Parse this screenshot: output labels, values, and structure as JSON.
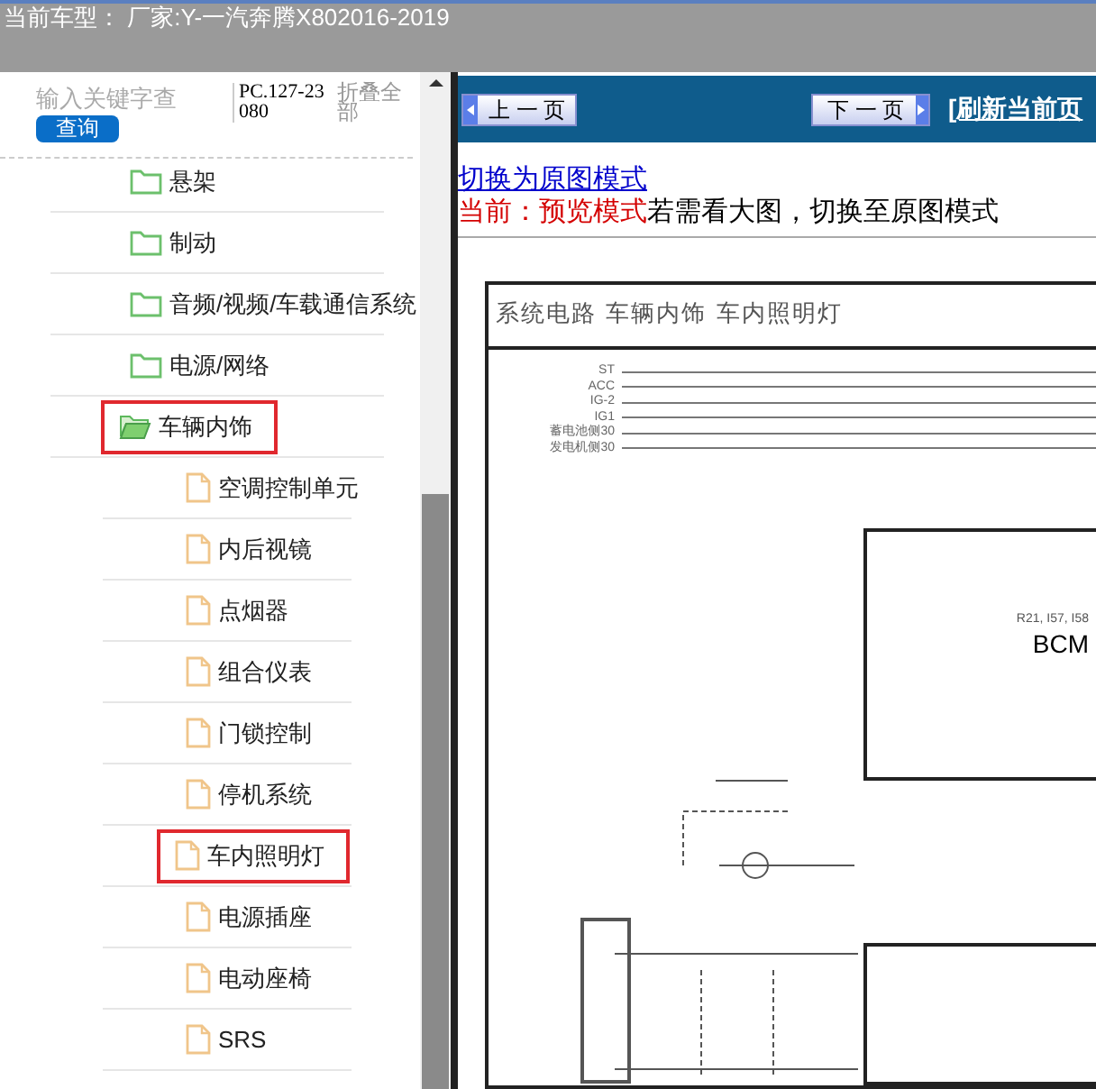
{
  "header": {
    "title": "当前车型： 厂家:Y-一汽奔腾X802016-2019"
  },
  "sidebar": {
    "search": {
      "placeholder": "输入关键字查",
      "button": "查询"
    },
    "code": "PC.127-23080",
    "collapse_all": "折叠全部",
    "tree": [
      {
        "label": "悬架",
        "kind": "folder",
        "expanded": false,
        "selected": false
      },
      {
        "label": "制动",
        "kind": "folder",
        "expanded": false,
        "selected": false
      },
      {
        "label": "音频/视频/车载通信系统",
        "kind": "folder",
        "expanded": false,
        "selected": false
      },
      {
        "label": "电源/网络",
        "kind": "folder",
        "expanded": false,
        "selected": false
      },
      {
        "label": "车辆内饰",
        "kind": "folder",
        "expanded": true,
        "selected": true,
        "children": [
          {
            "label": "空调控制单元",
            "kind": "file",
            "selected": false
          },
          {
            "label": "内后视镜",
            "kind": "file",
            "selected": false
          },
          {
            "label": "点烟器",
            "kind": "file",
            "selected": false
          },
          {
            "label": "组合仪表",
            "kind": "file",
            "selected": false
          },
          {
            "label": "门锁控制",
            "kind": "file",
            "selected": false
          },
          {
            "label": "停机系统",
            "kind": "file",
            "selected": false
          },
          {
            "label": "车内照明灯",
            "kind": "file",
            "selected": true
          },
          {
            "label": "电源插座",
            "kind": "file",
            "selected": false
          },
          {
            "label": "电动座椅",
            "kind": "file",
            "selected": false
          },
          {
            "label": "SRS",
            "kind": "file",
            "selected": false
          }
        ]
      }
    ]
  },
  "toolbar": {
    "prev": "上 一 页",
    "next": "下 一 页",
    "refresh": "[刷新当前页"
  },
  "mode": {
    "link": "切换为原图模式",
    "current": "当前：预览模式",
    "hint": "若需看大图，切换至原图模式"
  },
  "diagram": {
    "title": "系统电路 车辆内饰 车内照明灯",
    "buses": [
      "ST",
      "ACC",
      "IG-2",
      "IG1",
      "蓄电池侧30",
      "发电机侧30"
    ],
    "module_refs": "R21, I57, I58",
    "module": "BCM"
  }
}
